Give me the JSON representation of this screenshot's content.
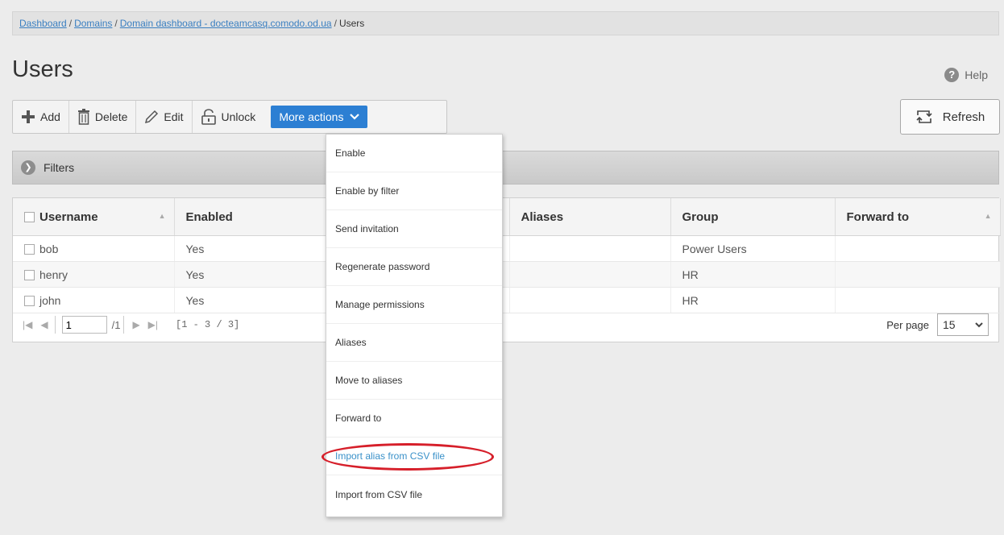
{
  "breadcrumb": {
    "dashboard": "Dashboard",
    "sep": "/",
    "domains": "Domains",
    "domain_dashboard": "Domain dashboard - docteamcasq.comodo.od.ua",
    "current": "Users"
  },
  "page": {
    "title": "Users",
    "help": "Help"
  },
  "toolbar": {
    "add": "Add",
    "delete": "Delete",
    "edit": "Edit",
    "unlock": "Unlock",
    "more_actions": "More actions",
    "refresh": "Refresh"
  },
  "filters": {
    "label": "Filters"
  },
  "table": {
    "columns": [
      "Username",
      "Enabled",
      "Aliases",
      "Group",
      "Forward to"
    ],
    "rows": [
      {
        "username": "bob",
        "enabled": "Yes",
        "aliases": "",
        "group": "Power Users",
        "forward_to": ""
      },
      {
        "username": "henry",
        "enabled": "Yes",
        "aliases": "",
        "group": "HR",
        "forward_to": ""
      },
      {
        "username": "john",
        "enabled": "Yes",
        "aliases": "",
        "group": "HR",
        "forward_to": ""
      }
    ]
  },
  "pager": {
    "page": "1",
    "of_pages": "/1",
    "range": "[1 - 3 / 3]",
    "per_page_label": "Per page",
    "per_page_value": "15"
  },
  "menu": {
    "items": [
      "Enable",
      "Enable by filter",
      "Send invitation",
      "Regenerate password",
      "Manage permissions",
      "Aliases",
      "Move to aliases",
      "Forward to",
      "Import alias from CSV file",
      "Import from CSV file"
    ],
    "highlighted_index": 8
  },
  "colors": {
    "accent": "#2c7fd3",
    "link": "#3a7fc1",
    "highlight_ring": "#d61f2a"
  }
}
